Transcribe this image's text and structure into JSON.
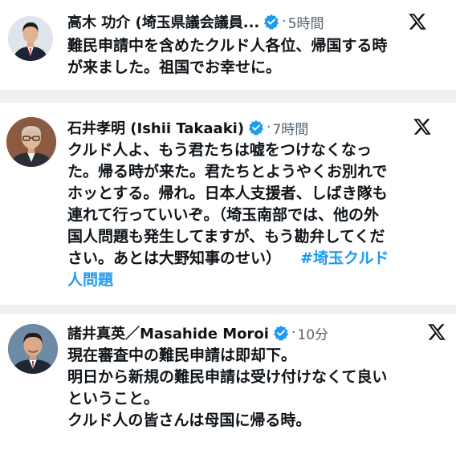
{
  "tweets": [
    {
      "name": "高木 功介 (埼玉県議会議員...",
      "dot": "·",
      "time": "5時間",
      "lines": [
        "難民申請中を含めたクルド人各位、帰国する時",
        "が来ました。祖国でお幸せに。"
      ],
      "avatar_icon": "politician-avatar",
      "platform_icon": "x-logo"
    },
    {
      "name": "石井孝明 (Ishii Takaaki)",
      "dot": "·",
      "time": "7時間",
      "lines": [
        "クルド人よ、もう君たちは嘘をつけなくなっ",
        "た。帰る時が来た。君たちとようやくお別れで",
        "ホッとする。帰れ。日本人支援者、しばき隊も",
        "連れて行っていいぞ。（埼玉南部では、他の外",
        "国人問題も発生してますが、もう勘弁してくだ",
        "さい。あとは大野知事のせい）"
      ],
      "hashtag_part1": "#埼玉クルド",
      "hashtag_part2": "人問題",
      "avatar_icon": "journalist-avatar",
      "platform_icon": "x-logo"
    },
    {
      "name": "諸井真英／Masahide Moroi",
      "dot": "·",
      "time": "10分",
      "lines": [
        "現在審査中の難民申請は即却下。",
        "明日から新規の難民申請は受け付けなくて良い",
        "ということ。",
        "クルド人の皆さんは母国に帰る時。"
      ],
      "avatar_icon": "politician-avatar",
      "platform_icon": "x-logo"
    }
  ],
  "colors": {
    "verified_blue": "#1d9bf0",
    "hashtag_blue": "#1d9bf0",
    "text": "#0f1419",
    "meta_gray": "#536471"
  }
}
